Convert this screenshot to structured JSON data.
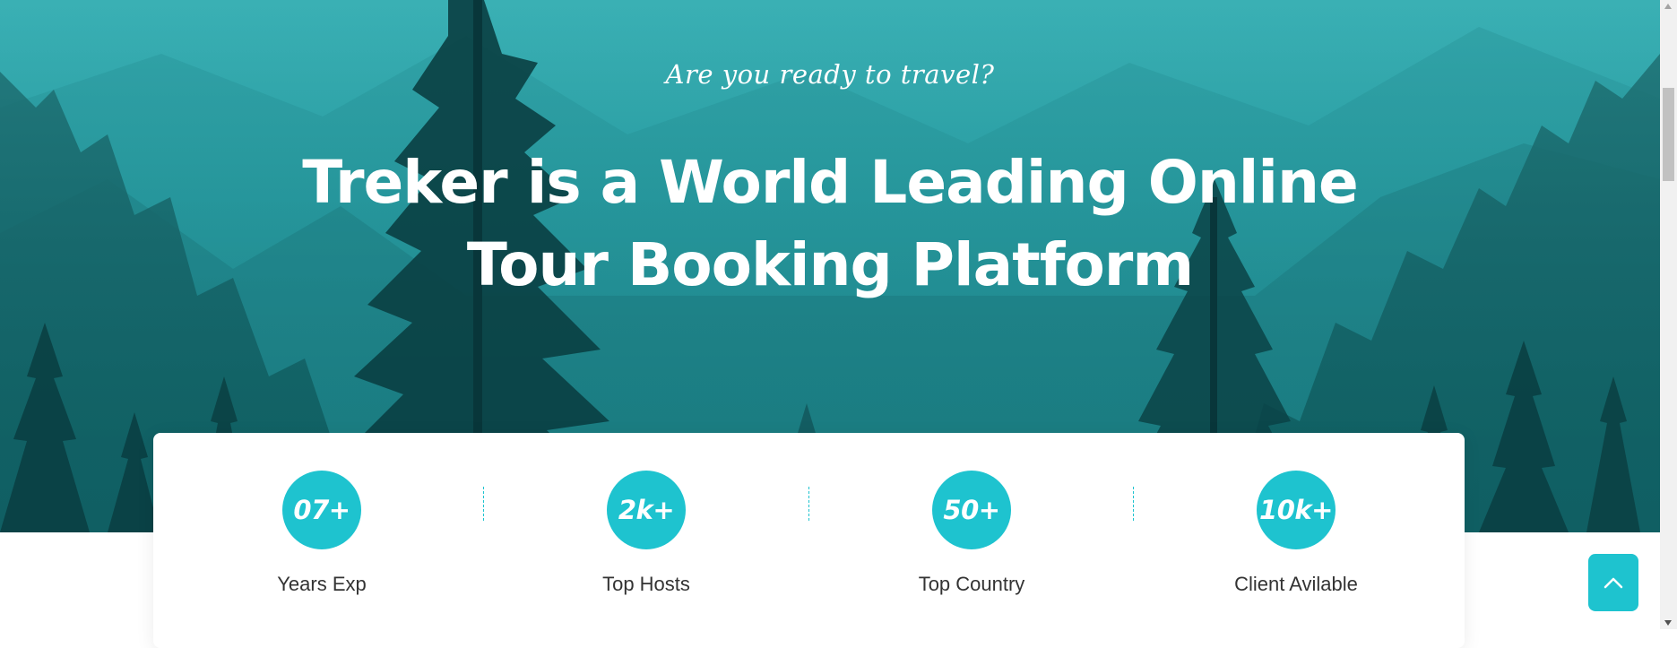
{
  "hero": {
    "tagline": "Are you ready to travel?",
    "headline_line1": "Treker is a World Leading Online",
    "headline_line2": "Tour Booking Platform"
  },
  "stats": [
    {
      "value": "07+",
      "label": "Years Exp"
    },
    {
      "value": "2k+",
      "label": "Top Hosts"
    },
    {
      "value": "50+",
      "label": "Top Country"
    },
    {
      "value": "10k+",
      "label": "Client Avilable"
    }
  ],
  "scroll_top_icon": "chevron-up-icon",
  "colors": {
    "accent": "#1ec3cf",
    "hero_teal": "#249ba1",
    "card_bg": "#ffffff",
    "label_text": "#333333"
  }
}
